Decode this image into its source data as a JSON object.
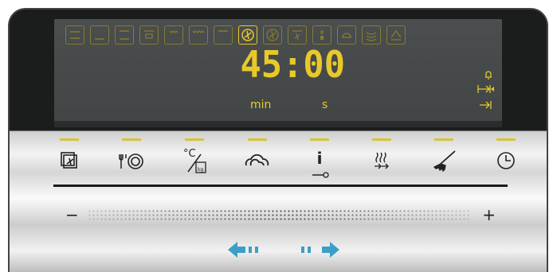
{
  "display": {
    "time": "45:00",
    "unit_min": "min",
    "unit_s": "s",
    "accent_color": "#e8c92a",
    "mode_icons": [
      "top-bottom-heat-icon",
      "bottom-heat-icon",
      "top-heat-icon",
      "grill-icon",
      "large-grill-icon",
      "full-grill-icon",
      "bottom-only-icon",
      "hot-air-icon",
      "fan-heat-icon",
      "fan-grill-icon",
      "defrost-icon",
      "pizza-icon",
      "slow-cook-icon",
      "warm-icon"
    ],
    "active_mode": "hot-air-icon",
    "timer_icons": [
      "bell-icon",
      "duration-icon",
      "end-time-icon"
    ]
  },
  "controls": [
    {
      "icon": "programs-icon",
      "label": ""
    },
    {
      "icon": "plate-icon",
      "label": ""
    },
    {
      "icon": "temperature-weight-icon",
      "label": "°C"
    },
    {
      "icon": "steam-icon",
      "label": ""
    },
    {
      "icon": "info-key-icon",
      "label": "i"
    },
    {
      "icon": "rapid-heat-icon",
      "label": ""
    },
    {
      "icon": "cleaning-brush-icon",
      "label": ""
    },
    {
      "icon": "clock-icon",
      "label": ""
    }
  ],
  "slider": {
    "minus": "−",
    "plus": "+"
  },
  "nav": {
    "left_icon": "arrow-left-icon",
    "right_icon": "arrow-right-icon",
    "color": "#3aa0c8"
  }
}
